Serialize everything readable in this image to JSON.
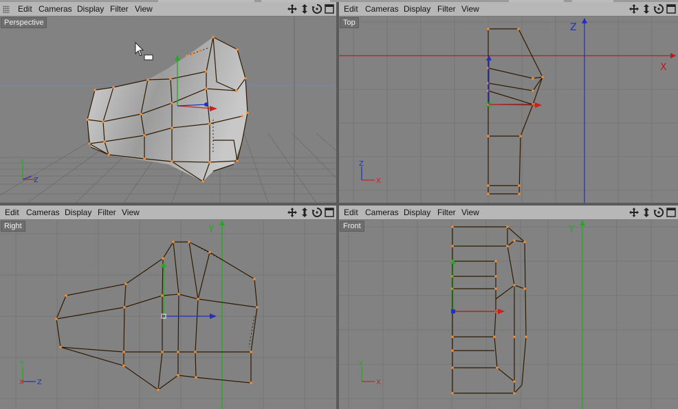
{
  "menu": {
    "edit": "Edit",
    "cameras": "Cameras",
    "display": "Display",
    "filter": "Filter",
    "view": "View"
  },
  "views": {
    "perspective": {
      "label": "Perspective"
    },
    "top": {
      "label": "Top",
      "axis_h": "X",
      "axis_v": "Z"
    },
    "right": {
      "label": "Right",
      "axis_v": "Y"
    },
    "front": {
      "label": "Front",
      "axis_v": "Y"
    }
  },
  "mini_axes": {
    "x": "X",
    "y": "Y",
    "z": "Z"
  },
  "icons": [
    "move-view-icon",
    "dolly-view-icon",
    "rotate-view-icon",
    "maximize-view-icon"
  ],
  "colors": {
    "x_axis": "#cc2020",
    "y_axis": "#22aa22",
    "z_axis": "#2030c0",
    "vertex": "#ff8c2a",
    "edge": "#3a2000"
  }
}
